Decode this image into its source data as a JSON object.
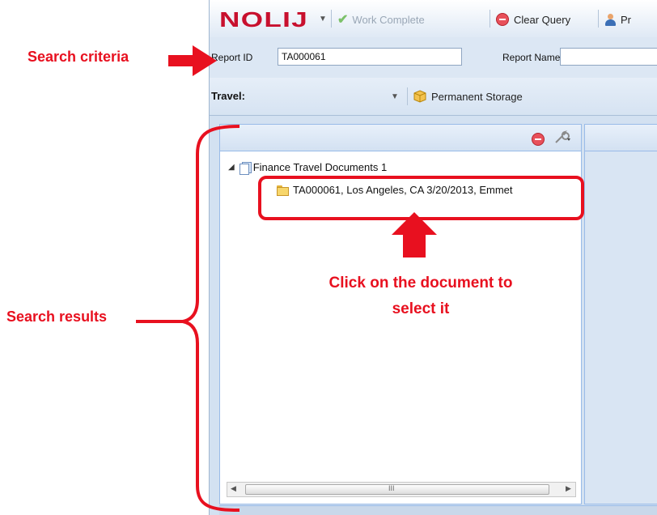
{
  "app": {
    "logo": "NOLIJ",
    "toolbar": {
      "work_complete": "Work Complete",
      "clear_query": "Clear Query",
      "partial_next": "Pr"
    },
    "criteria": {
      "report_id_label": "Report ID",
      "report_id_value": "TA000061",
      "report_name_label": "Report Name",
      "report_name_value": ""
    },
    "storage": {
      "label": "Travel:",
      "permanent_storage": "Permanent Storage"
    },
    "tree": {
      "root_label": "Finance Travel Documents 1",
      "document_label": "TA000061, Los Angeles, CA 3/20/2013, Emmet"
    },
    "scroll_grip": "III"
  },
  "annotations": {
    "search_criteria": "Search criteria",
    "search_results": "Search results",
    "click_line1": "Click on the document to",
    "click_line2": "select it"
  },
  "colors": {
    "annotation_red": "#e8101f",
    "logo_red": "#c8102e",
    "panel_blue": "#99bbe8"
  }
}
